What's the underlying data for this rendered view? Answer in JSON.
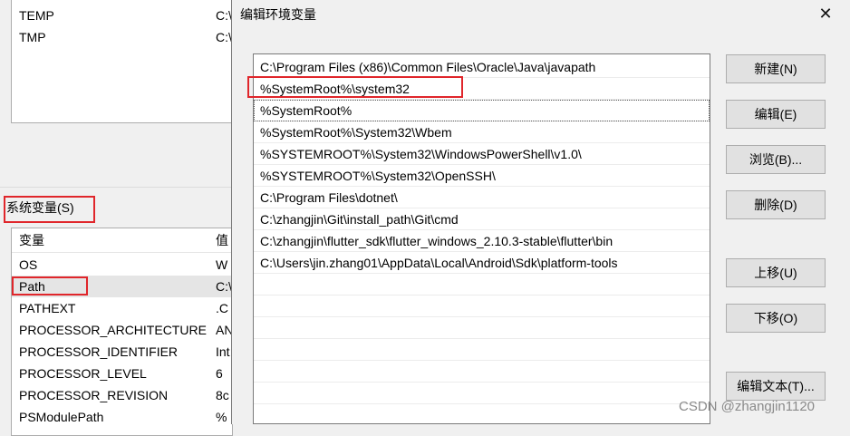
{
  "background": {
    "user_vars": [
      {
        "name": "TEMP",
        "value": "C:\\"
      },
      {
        "name": "TMP",
        "value": "C:\\"
      }
    ],
    "system_vars_label": "系统变量(S)",
    "columns": {
      "variable": "变量",
      "value": "值"
    },
    "system_vars": [
      {
        "name": "OS",
        "value": "W"
      },
      {
        "name": "Path",
        "value": "C:\\"
      },
      {
        "name": "PATHEXT",
        "value": ".C"
      },
      {
        "name": "PROCESSOR_ARCHITECTURE",
        "value": "AN"
      },
      {
        "name": "PROCESSOR_IDENTIFIER",
        "value": "Int"
      },
      {
        "name": "PROCESSOR_LEVEL",
        "value": "6"
      },
      {
        "name": "PROCESSOR_REVISION",
        "value": "8c"
      },
      {
        "name": "PSModulePath",
        "value": "%"
      }
    ]
  },
  "dialog": {
    "title": "编辑环境变量",
    "close_icon": "close-icon",
    "paths": [
      "C:\\Program Files (x86)\\Common Files\\Oracle\\Java\\javapath",
      "%SystemRoot%\\system32",
      "%SystemRoot%",
      "%SystemRoot%\\System32\\Wbem",
      "%SYSTEMROOT%\\System32\\WindowsPowerShell\\v1.0\\",
      "%SYSTEMROOT%\\System32\\OpenSSH\\",
      "C:\\Program Files\\dotnet\\",
      "C:\\zhangjin\\Git\\install_path\\Git\\cmd",
      "C:\\zhangjin\\flutter_sdk\\flutter_windows_2.10.3-stable\\flutter\\bin",
      "C:\\Users\\jin.zhang01\\AppData\\Local\\Android\\Sdk\\platform-tools"
    ],
    "buttons": {
      "new": "新建(N)",
      "edit": "编辑(E)",
      "browse": "浏览(B)...",
      "delete": "删除(D)",
      "move_up": "上移(U)",
      "move_down": "下移(O)",
      "edit_text": "编辑文本(T)..."
    }
  },
  "highlight_color": "#e0262b",
  "watermark": "CSDN @zhangjin1120"
}
